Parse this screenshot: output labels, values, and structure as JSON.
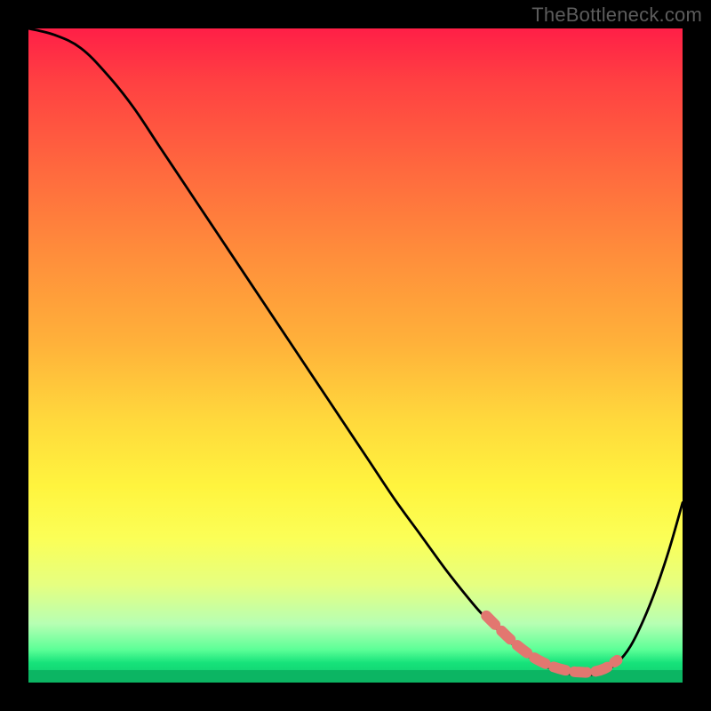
{
  "watermark": "TheBottleneck.com",
  "colors": {
    "frame_bg": "#000000",
    "watermark_text": "#5c5c5c",
    "curve_stroke": "#000000",
    "marker_stroke": "#e27770",
    "gradient_top": "#ff1f47",
    "gradient_bottom": "#0cb563"
  },
  "chart_data": {
    "type": "line",
    "title": "",
    "xlabel": "",
    "ylabel": "",
    "xlim": [
      0,
      100
    ],
    "ylim": [
      0,
      100
    ],
    "grid": false,
    "legend": false,
    "series": [
      {
        "name": "bottleneck-curve",
        "x": [
          0,
          4,
          8,
          12,
          16,
          20,
          24,
          28,
          32,
          36,
          40,
          44,
          48,
          52,
          56,
          60,
          64,
          68,
          70,
          72,
          74,
          76,
          78,
          80,
          82,
          84,
          86,
          88,
          90,
          92,
          94,
          96,
          98,
          100
        ],
        "values": [
          100,
          99,
          97,
          93,
          88,
          82,
          76,
          70,
          64,
          58,
          52,
          46,
          40,
          34,
          28,
          22.5,
          17,
          12,
          9.8,
          7.8,
          5.9,
          4.3,
          3.0,
          2.1,
          1.5,
          1.2,
          1.2,
          1.7,
          3.0,
          5.5,
          9.5,
          14.5,
          20.5,
          27.5
        ]
      }
    ],
    "annotations": [
      {
        "name": "optimal-band",
        "x_range": [
          70,
          90
        ],
        "note": "highlighted dashed segment near curve minimum"
      }
    ]
  }
}
